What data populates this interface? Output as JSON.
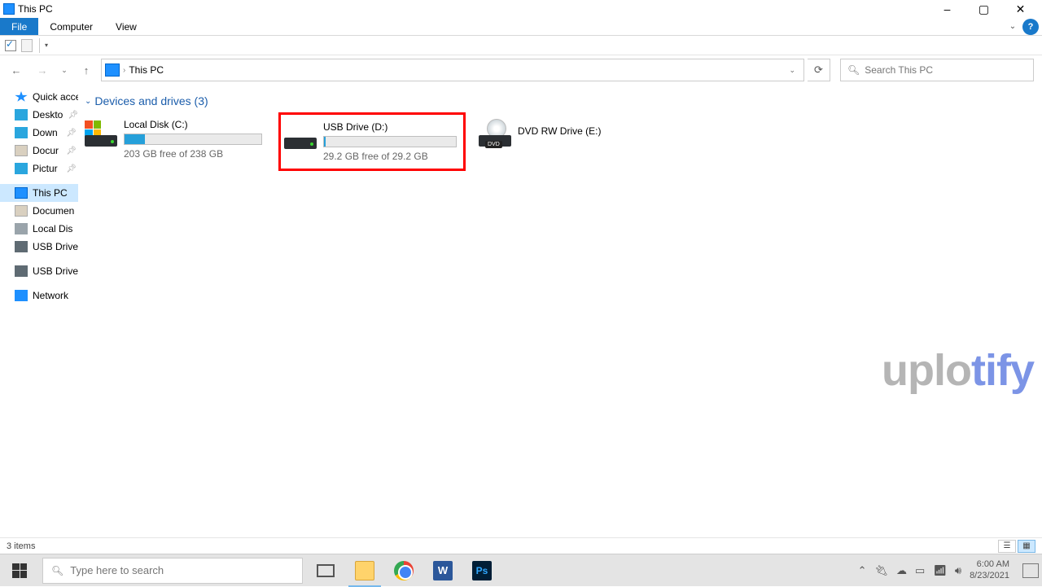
{
  "window": {
    "title": "This PC"
  },
  "ribbon": {
    "file": "File",
    "computer": "Computer",
    "view": "View"
  },
  "address": {
    "location": "This PC"
  },
  "search": {
    "placeholder": "Search This PC"
  },
  "sidebar": {
    "quick_access": "Quick acce",
    "desktop": "Deskto",
    "downloads": "Down",
    "documents": "Docur",
    "pictures": "Pictur",
    "this_pc": "This PC",
    "documents2": "Documen",
    "local_disk": "Local Dis",
    "usb_drive": "USB Drive",
    "usb_drive2": "USB Drive (",
    "network": "Network"
  },
  "section": {
    "header": "Devices and drives (3)"
  },
  "drives": [
    {
      "name": "Local Disk (C:)",
      "free_text": "203 GB free of 238 GB",
      "fill_pct": 15
    },
    {
      "name": "USB Drive (D:)",
      "free_text": "29.2 GB free of 29.2 GB",
      "fill_pct": 1
    },
    {
      "name": "DVD RW Drive (E:)",
      "free_text": "",
      "fill_pct": 0
    }
  ],
  "status": {
    "items": "3 items"
  },
  "taskbar": {
    "search_placeholder": "Type here to search",
    "time": "6:00 AM",
    "date": "8/23/2021"
  },
  "watermark": {
    "part1": "uplo",
    "part2": "tify"
  }
}
